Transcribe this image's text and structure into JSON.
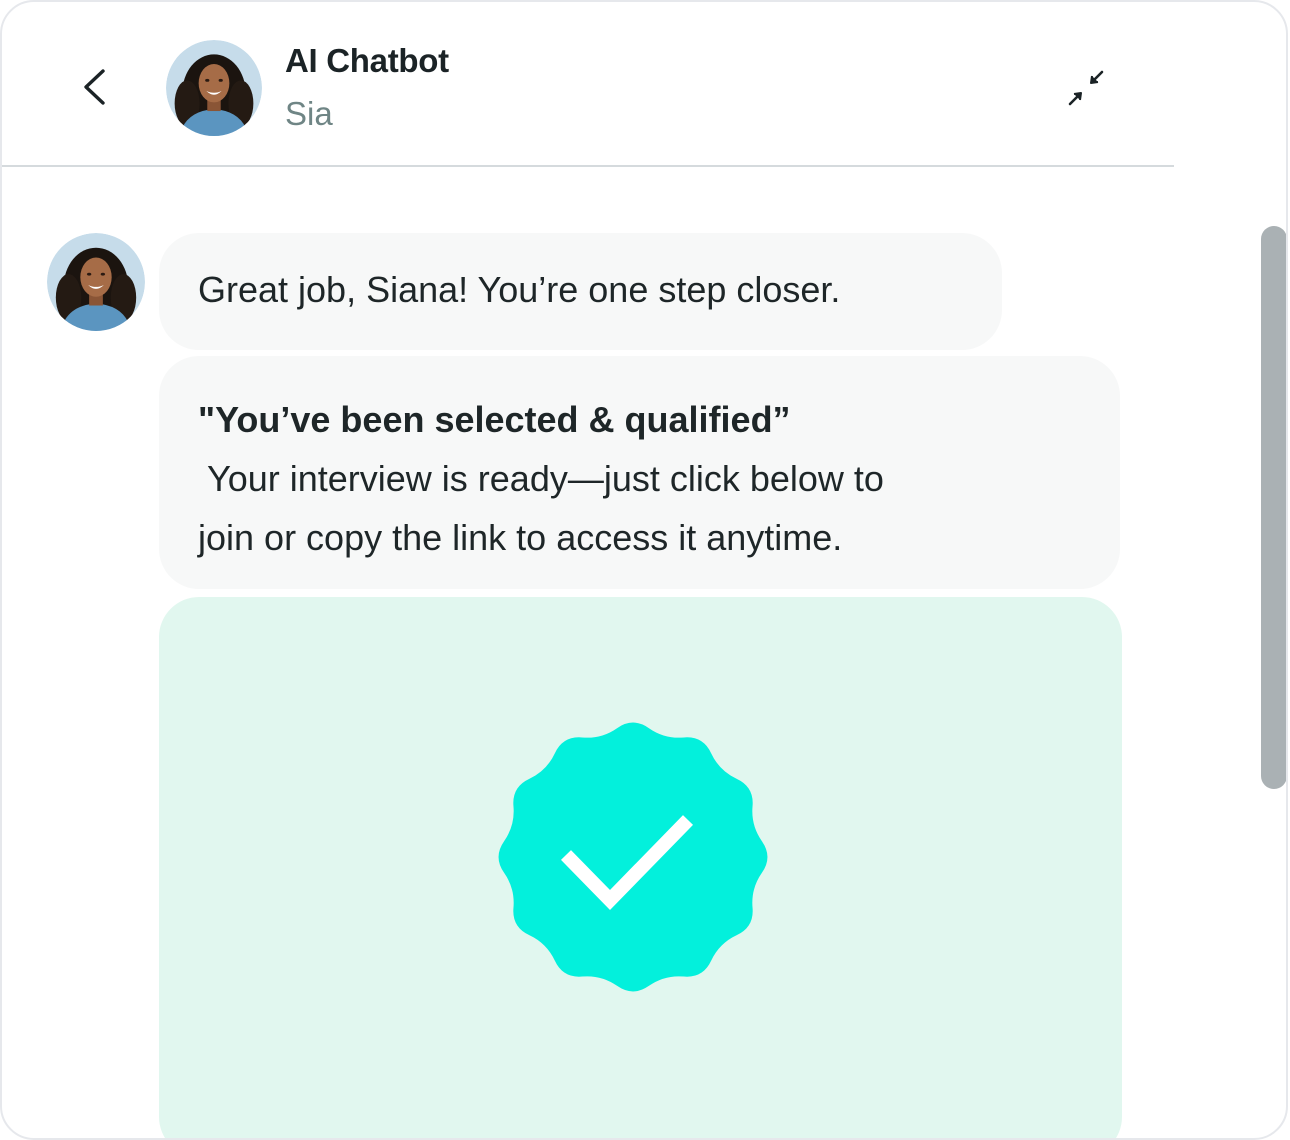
{
  "header": {
    "title": "AI Chatbot",
    "subtitle": "Sia"
  },
  "icons": {
    "back": "chevron-left-icon",
    "minimize": "minimize-arrows-icon",
    "verified": "verified-badge-check-icon"
  },
  "messages": [
    {
      "sender": "Sia",
      "text": "Great job, Siana! You’re one step closer."
    },
    {
      "sender": "Sia",
      "heading": "\"You’ve been selected & qualified”",
      "body_line_1": "Your interview is ready—just click below to",
      "body_line_2": "join or copy the link to access it anytime."
    }
  ],
  "colors": {
    "accent_badge": "#03f0dc",
    "card_background": "#e1f7ef",
    "bubble_background": "#f7f8f8",
    "subtitle_text": "#6f8585"
  }
}
